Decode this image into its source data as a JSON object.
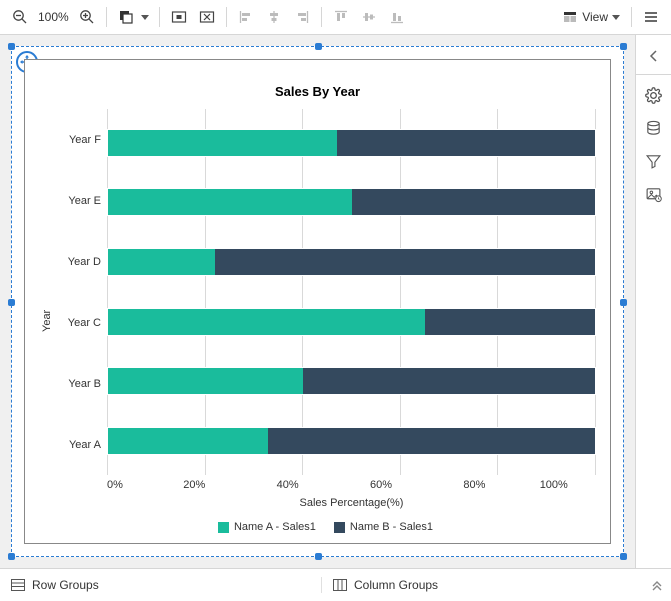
{
  "toolbar": {
    "zoom": "100%",
    "view_label": "View"
  },
  "right_panel": {
    "items": [
      "properties",
      "data",
      "filter",
      "image-manager"
    ]
  },
  "groups": {
    "row_label": "Row Groups",
    "col_label": "Column Groups"
  },
  "chart_data": {
    "type": "bar",
    "orientation": "horizontal-stacked-100",
    "title": "Sales By Year",
    "xlabel": "Sales Percentage(%)",
    "ylabel": "Year",
    "xlim": [
      0,
      100
    ],
    "ticks": [
      "0%",
      "20%",
      "40%",
      "60%",
      "80%",
      "100%"
    ],
    "categories": [
      "Year F",
      "Year E",
      "Year D",
      "Year C",
      "Year B",
      "Year A"
    ],
    "series": [
      {
        "name": "Name A - Sales1",
        "color": "#1abc9c",
        "values": [
          47,
          50,
          22,
          65,
          40,
          33
        ]
      },
      {
        "name": "Name B - Sales1",
        "color": "#34495e",
        "values": [
          53,
          50,
          78,
          35,
          60,
          67
        ]
      }
    ],
    "legend_position": "bottom"
  }
}
